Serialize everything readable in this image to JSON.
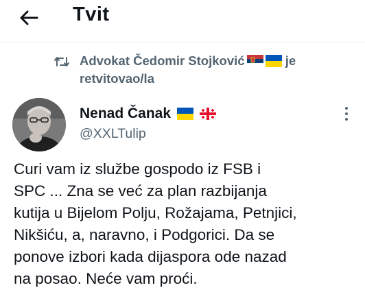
{
  "header": {
    "title": "Tvit",
    "back_icon": "arrow-left-icon"
  },
  "retweet": {
    "icon": "retweet-icon",
    "line1": "Advokat Čedomir Stojković",
    "flags": [
      "flag-serbia-icon",
      "flag-ukraine-icon"
    ],
    "line1_suffix": "je",
    "line2": "retvitovao/la"
  },
  "author": {
    "name": "Nenad Čanak",
    "flags": [
      "flag-ukraine-icon",
      "flag-georgia-icon"
    ],
    "handle": "@XXLTulip"
  },
  "tweet": {
    "lines": [
      "Curi vam iz službe gospodo iz FSB i",
      "SPC ... Zna se već za plan razbijanja",
      "kutija u Bijelom Polju, Rožajama, Petnjici,",
      "Nikšiću, a, naravno, i Podgorici. Da se",
      "ponove izbori kada dijaspora ode nazad",
      "na posao. Neće vam proći."
    ]
  },
  "colors": {
    "text": "#0f1419",
    "secondary": "#536471",
    "divider": "#eff3f4"
  }
}
